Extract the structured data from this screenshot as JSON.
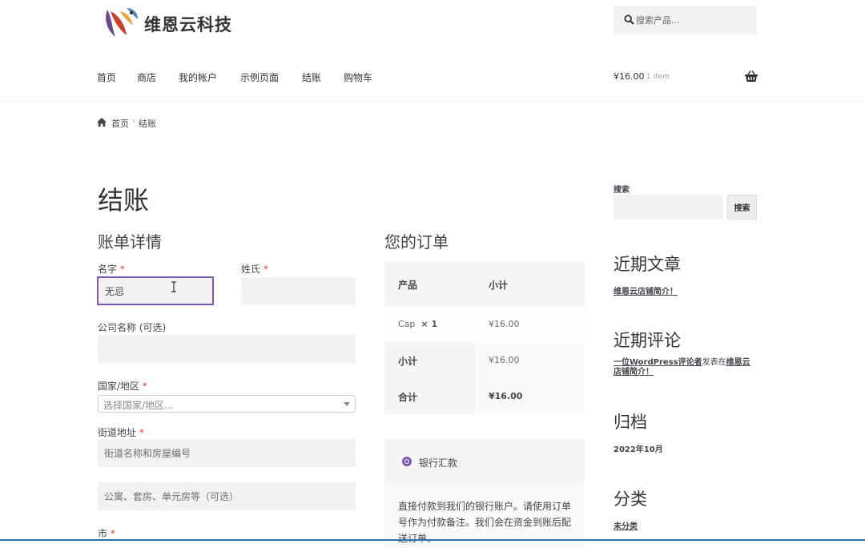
{
  "header": {
    "site_name": "维恩云科技",
    "search_placeholder": "搜索产品…",
    "nav": [
      "首页",
      "商店",
      "我的帐户",
      "示例页面",
      "结账",
      "购物车"
    ],
    "cart_amount": "¥16.00",
    "cart_count": "1 item"
  },
  "breadcrumb": {
    "home": "首页",
    "current": "结账"
  },
  "page_title": "结账",
  "billing": {
    "title": "账单详情",
    "first_name_label": "名字",
    "first_name_value": "无忌",
    "last_name_label": "姓氏",
    "company_label": "公司名称 (可选)",
    "country_label": "国家/地区",
    "country_placeholder": "选择国家/地区…",
    "street_label": "街道地址",
    "street_placeholder": "街道名称和房屋编号",
    "apartment_placeholder": "公寓、套房、单元房等（可选）",
    "city_label": "市",
    "required_mark": "*"
  },
  "order": {
    "title": "您的订单",
    "col_product": "产品",
    "col_subtotal": "小计",
    "item_name": "Cap",
    "item_qty": "× 1",
    "item_price": "¥16.00",
    "subtotal_label": "小计",
    "subtotal_value": "¥16.00",
    "total_label": "合计",
    "total_value": "¥16.00"
  },
  "payment": {
    "method_label": "银行汇款",
    "description": "直接付款到我们的银行账户。请使用订单号作为付款备注。我们会在资金到账后配送订单。"
  },
  "sidebar": {
    "search_label": "搜索",
    "search_button": "搜索",
    "recent_posts_title": "近期文章",
    "recent_post": "维恩云店铺简介！",
    "recent_comments_title": "近期评论",
    "comment_author": "一位WordPress评论者",
    "comment_on": "发表在",
    "comment_post": "维恩云店铺简介！",
    "archives_title": "归档",
    "archive_item": "2022年10月",
    "categories_title": "分类",
    "category_item": "未分类"
  },
  "colors": {
    "accent": "#7f54b3",
    "required": "#e2401c",
    "field_bg": "#f2f2f2"
  }
}
